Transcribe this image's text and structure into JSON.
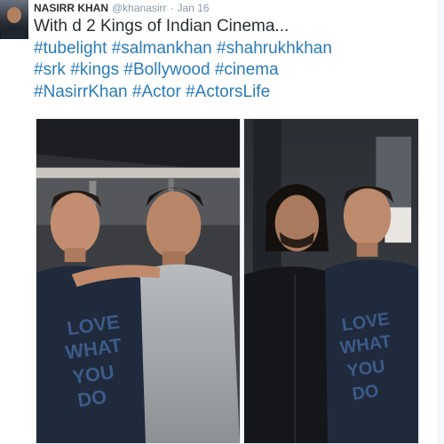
{
  "tweet": {
    "author_name": "NASIRR KHAN",
    "handle": "@khanasirr",
    "separator": "·",
    "date": "Jan 16",
    "text_line1": "With d 2 Kings of Indian Cinema...",
    "hashtags": {
      "line2": [
        "#tubelight",
        "#salmankhan",
        "#shahrukhkhan"
      ],
      "line3": [
        "#srk",
        "#kings",
        "#Bollywood",
        "#cinema"
      ],
      "line4": [
        "#NasirrKhan",
        "#Actor",
        "#ActorsLife"
      ]
    }
  },
  "media": {
    "shirt_text_left": "LOVE WHAT YOU DO",
    "shirt_text_right": "LOVE WHAT YOU DO"
  },
  "colors": {
    "hashtag": "#2b7bb9",
    "name": "#292f33",
    "meta": "#8899a6"
  }
}
